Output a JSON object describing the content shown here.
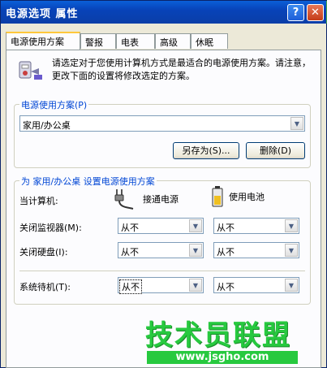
{
  "window": {
    "title": "电源选项 属性",
    "help_label": "?",
    "close_label": "✕"
  },
  "tabs": [
    {
      "label": "电源使用方案",
      "active": true
    },
    {
      "label": "警报",
      "active": false
    },
    {
      "label": "电表",
      "active": false
    },
    {
      "label": "高级",
      "active": false
    },
    {
      "label": "休眠",
      "active": false
    }
  ],
  "intro": {
    "text": "请选定对于您使用计算机方式是最适合的电源使用方案。请注意，更改下面的设置将修改选定的方案。",
    "icon": "power-scheme-icon"
  },
  "schemes": {
    "legend": "电源使用方案(P)",
    "selected": "家用/办公桌",
    "save_as_label": "另存为(S)...",
    "delete_label": "删除(D)"
  },
  "settings": {
    "legend": "为 家用/办公桌 设置电源使用方案",
    "computer_label": "当计算机:",
    "plugged_in_label": "接通电源",
    "battery_label": "使用电池",
    "plug_icon": "plug-icon",
    "battery_icon": "battery-icon",
    "rows": [
      {
        "label": "关闭监视器(M):",
        "ac": "从不",
        "dc": "从不"
      },
      {
        "label": "关闭硬盘(I):",
        "ac": "从不",
        "dc": "从不"
      },
      {
        "label": "系统待机(T):",
        "ac": "从不",
        "dc": "从不"
      }
    ]
  },
  "watermark": {
    "name": "技术员联盟",
    "url": "www.jsgho.com"
  }
}
